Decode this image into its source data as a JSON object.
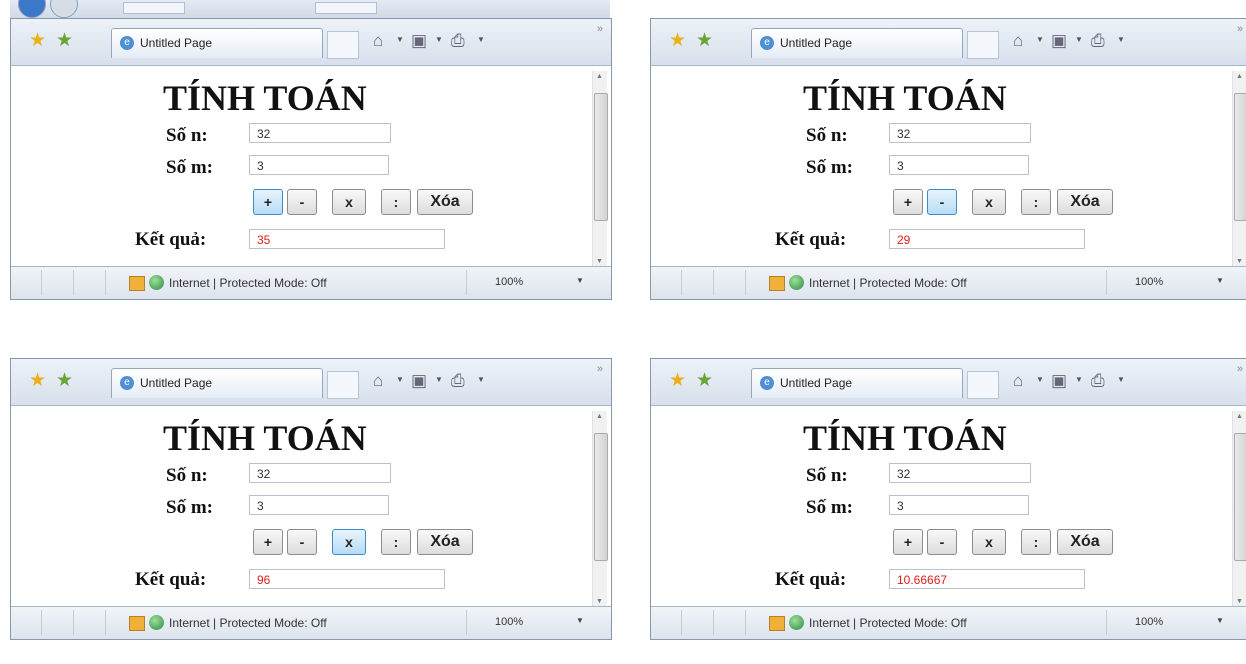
{
  "windows": [
    {
      "tab_title": "Untitled Page",
      "heading": "TÍNH TOÁN",
      "label_n": "Số n:",
      "value_n": "32",
      "label_m": "Số m:",
      "value_m": "3",
      "buttons": {
        "add": "+",
        "subtract": "-",
        "multiply": "x",
        "divide": ":",
        "clear": "Xóa"
      },
      "active_operation": "add",
      "result_label": "Kết quả:",
      "result_value": "35",
      "status_text": "Internet | Protected Mode: Off",
      "zoom": "100%"
    },
    {
      "tab_title": "Untitled Page",
      "heading": "TÍNH TOÁN",
      "label_n": "Số n:",
      "value_n": "32",
      "label_m": "Số m:",
      "value_m": "3",
      "buttons": {
        "add": "+",
        "subtract": "-",
        "multiply": "x",
        "divide": ":",
        "clear": "Xóa"
      },
      "active_operation": "subtract",
      "result_label": "Kết quả:",
      "result_value": "29",
      "status_text": "Internet | Protected Mode: Off",
      "zoom": "100%"
    },
    {
      "tab_title": "Untitled Page",
      "heading": "TÍNH TOÁN",
      "label_n": "Số n:",
      "value_n": "32",
      "label_m": "Số m:",
      "value_m": "3",
      "buttons": {
        "add": "+",
        "subtract": "-",
        "multiply": "x",
        "divide": ":",
        "clear": "Xóa"
      },
      "active_operation": "multiply",
      "result_label": "Kết quả:",
      "result_value": "96",
      "status_text": "Internet | Protected Mode: Off",
      "zoom": "100%"
    },
    {
      "tab_title": "Untitled Page",
      "heading": "TÍNH TOÁN",
      "label_n": "Số n:",
      "value_n": "32",
      "label_m": "Số m:",
      "value_m": "3",
      "buttons": {
        "add": "+",
        "subtract": "-",
        "multiply": "x",
        "divide": ":",
        "clear": "Xóa"
      },
      "active_operation": "none",
      "result_label": "Kết quả:",
      "result_value": "10.66667",
      "status_text": "Internet | Protected Mode: Off",
      "zoom": "100%"
    }
  ],
  "colors": {
    "result_text": "#e0201a",
    "active_button": "#b7dcf6",
    "window_border": "#8797ad"
  }
}
